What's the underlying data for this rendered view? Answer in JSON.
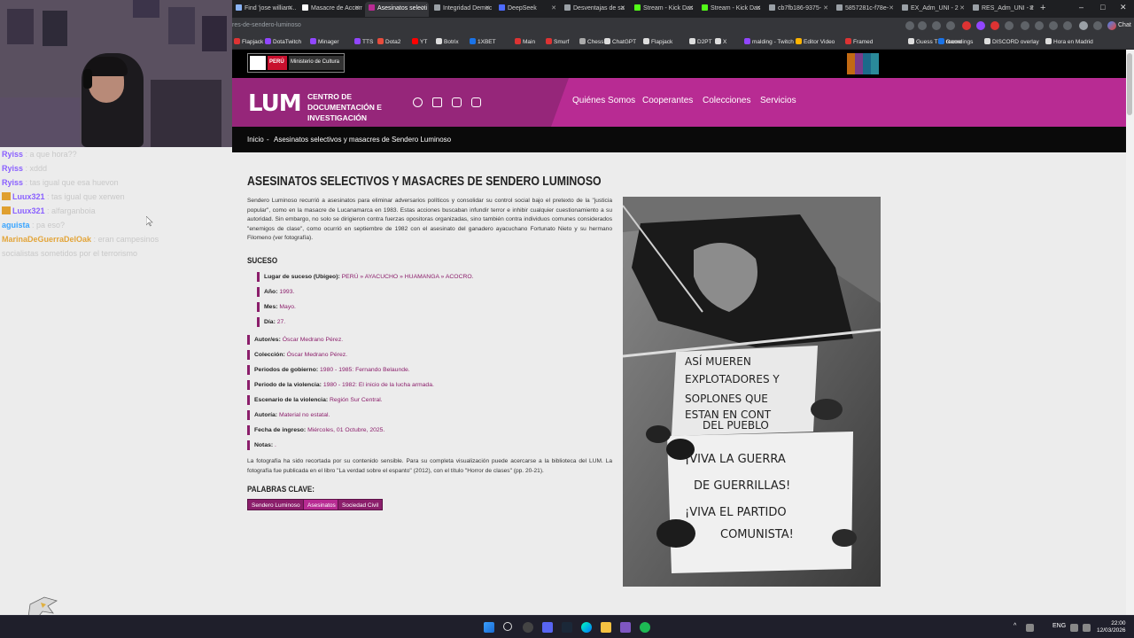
{
  "browser": {
    "tabs": [
      {
        "label": "Find 'jose william...",
        "icon_color": "#8ab4f8",
        "active": false
      },
      {
        "label": "Masacre de Accom",
        "icon_color": "#ffffff",
        "active": false
      },
      {
        "label": "Asesinatos selecti",
        "icon_color": "#b82b93",
        "active": true
      },
      {
        "label": "Integridad Democ",
        "icon_color": "#9aa0a6",
        "active": false
      },
      {
        "label": "DeepSeek",
        "icon_color": "#4d6bfe",
        "active": false
      },
      {
        "label": "Desventajas de sa",
        "icon_color": "#9aa0a6",
        "active": false
      },
      {
        "label": "Stream - Kick Das",
        "icon_color": "#53fc18",
        "active": false
      },
      {
        "label": "Stream - Kick Das",
        "icon_color": "#53fc18",
        "active": false
      },
      {
        "label": "cb7fb186-9375-",
        "icon_color": "#9aa0a6",
        "active": false
      },
      {
        "label": "5857281c-f78e-",
        "icon_color": "#9aa0a6",
        "active": false
      },
      {
        "label": "EX_Adm_UNI - 2",
        "icon_color": "#9aa0a6",
        "active": false
      },
      {
        "label": "RES_Adm_UNI - 2",
        "icon_color": "#9aa0a6",
        "active": false
      }
    ],
    "new_tab": "+",
    "window_controls": [
      "–",
      "□",
      "✕"
    ],
    "url": "res-de-sendero-luminoso",
    "extension_label": "Chat",
    "bookmarks": [
      {
        "label": "Flapjack",
        "color": "#d33"
      },
      {
        "label": "DotaTwitch",
        "color": "#9146ff"
      },
      {
        "label": "Minager",
        "color": "#9146ff"
      },
      {
        "label": "TTS",
        "color": "#9146ff"
      },
      {
        "label": "Dota2",
        "color": "#e74c3c"
      },
      {
        "label": "YT",
        "color": "#ff0000"
      },
      {
        "label": "Botrix",
        "color": "#ddd"
      },
      {
        "label": "1XBET",
        "color": "#1a73e8"
      },
      {
        "label": "Main",
        "color": "#d33"
      },
      {
        "label": "Smurf",
        "color": "#d33"
      },
      {
        "label": "Chess",
        "color": "#aaa"
      },
      {
        "label": "ChatGPT",
        "color": "#ddd"
      },
      {
        "label": "Flapjack",
        "color": "#ddd"
      },
      {
        "label": "D2PT",
        "color": "#ddd"
      },
      {
        "label": "X",
        "color": "#ddd"
      },
      {
        "label": "malding - Twitch",
        "color": "#9146ff"
      },
      {
        "label": "Editor Video",
        "color": "#ffb400"
      },
      {
        "label": "Framed",
        "color": "#d33"
      },
      {
        "label": "Guess The Game",
        "color": "#ddd"
      },
      {
        "label": "recordings",
        "color": "#1a73e8"
      },
      {
        "label": "DISCORD overlay",
        "color": "#ddd"
      },
      {
        "label": "Hora en Madrid",
        "color": "#ddd"
      }
    ]
  },
  "chat": [
    {
      "user": "Ryiss",
      "color": "#8a60ff",
      "msg": "a que hora??",
      "badge": false
    },
    {
      "user": "Ryiss",
      "color": "#8a60ff",
      "msg": "xddd",
      "badge": false
    },
    {
      "user": "Ryiss",
      "color": "#8a60ff",
      "msg": "tas igual que esa huevon",
      "badge": false
    },
    {
      "user": "Luux321",
      "color": "#8a60ff",
      "msg": "tas igual que xerwen",
      "badge": true
    },
    {
      "user": "Luux321",
      "color": "#8a60ff",
      "msg": "alfarganboia",
      "badge": true
    },
    {
      "user": "aguista",
      "color": "#3aa5ff",
      "msg": "pa eso?",
      "badge": false
    },
    {
      "user": "MarinaDeGuerraDelOak",
      "color": "#e3a53a",
      "msg": "eran campesinos socialistas sometidos por el terrorismo",
      "badge": false
    }
  ],
  "site": {
    "gov": {
      "peru": "PERÚ",
      "ministry": "Ministerio de Cultura"
    },
    "logo": "LUM",
    "logo_sub": "CENTRO DE DOCUMENTACIÓN E INVESTIGACIÓN",
    "social_icons": [
      "facebook-icon",
      "twitter-icon",
      "youtube-icon",
      "instagram-icon"
    ],
    "nav": [
      "Quiénes Somos",
      "Cooperantes",
      "Colecciones",
      "Servicios"
    ],
    "breadcrumb": {
      "home": "Inicio",
      "sep": "-",
      "current": "Asesinatos selectivos y masacres de Sendero Luminoso"
    },
    "title": "ASESINATOS SELECTIVOS Y MASACRES DE SENDERO LUMINOSO",
    "intro": "Sendero Luminoso recurrió a asesinatos para eliminar adversarios políticos y consolidar su control social bajo el pretexto de la \"justicia popular\", como en la masacre de Lucanamarca en 1983. Estas acciones buscaban infundir terror e inhibir cualquier cuestionamiento a su autoridad. Sin embargo, no solo se dirigieron contra fuerzas opositoras organizadas, sino también contra individuos comunes considerados \"enemigos de clase\", como ocurrió en septiembre de 1982 con el asesinato del ganadero ayacuchano Fortunato Nieto y su hermano Filomeno (ver fotografía).",
    "suceso_heading": "SUCESO",
    "suceso": [
      {
        "label": "Lugar de suceso (Ubigeo):",
        "value": "PERÚ » AYACUCHO » HUAMANGA » ACOCRO."
      },
      {
        "label": "Año:",
        "value": "1993."
      },
      {
        "label": "Mes:",
        "value": "Mayo."
      },
      {
        "label": "Día:",
        "value": "27."
      }
    ],
    "meta": [
      {
        "label": "Autor/es:",
        "value": "Óscar Medrano Pérez."
      },
      {
        "label": "Colección:",
        "value": "Óscar Medrano Pérez."
      },
      {
        "label": "Periodos de gobierno:",
        "value": "1980 - 1985: Fernando Belaunde."
      },
      {
        "label": "Periodo de la violencia:",
        "value": "1980 - 1982: El inicio de la lucha armada."
      },
      {
        "label": "Escenario de la violencia:",
        "value": "Región Sur Central."
      },
      {
        "label": "Autoría:",
        "value": "Material no estatal."
      },
      {
        "label": "Fecha de ingreso:",
        "value": "Miércoles, 01 Octubre, 2025."
      },
      {
        "label": "Notas:",
        "value": "."
      }
    ],
    "photo_note": "La fotografía ha sido recortada por su contenido sensible. Para su completa visualización puede acercarse a la biblioteca del LUM. La fotografía fue publicada en el libro \"La verdad sobre el espanto\" (2012), con el título \"Horror de clases\" (pp. 20-21).",
    "keywords_heading": "PALABRAS CLAVE:",
    "keywords": [
      "Sendero Luminoso",
      "Asesinatos",
      "Sociedad Civil"
    ],
    "photo_text": {
      "sign1": [
        "ASÍ MUEREN",
        "EXPLOTADORES Y",
        "SOPLONES QUE",
        "ESTAN EN CONT",
        "DEL PUEBLO"
      ],
      "sign2": [
        "¡VIVA LA GUERRA",
        "DE GUERRILLAS!",
        "¡VIVA EL PARTIDO",
        "COMUNISTA!"
      ]
    }
  },
  "taskbar": {
    "lang": "ENG",
    "time": "22:00",
    "date": "12/03/2026",
    "tray_arrow": "^"
  }
}
